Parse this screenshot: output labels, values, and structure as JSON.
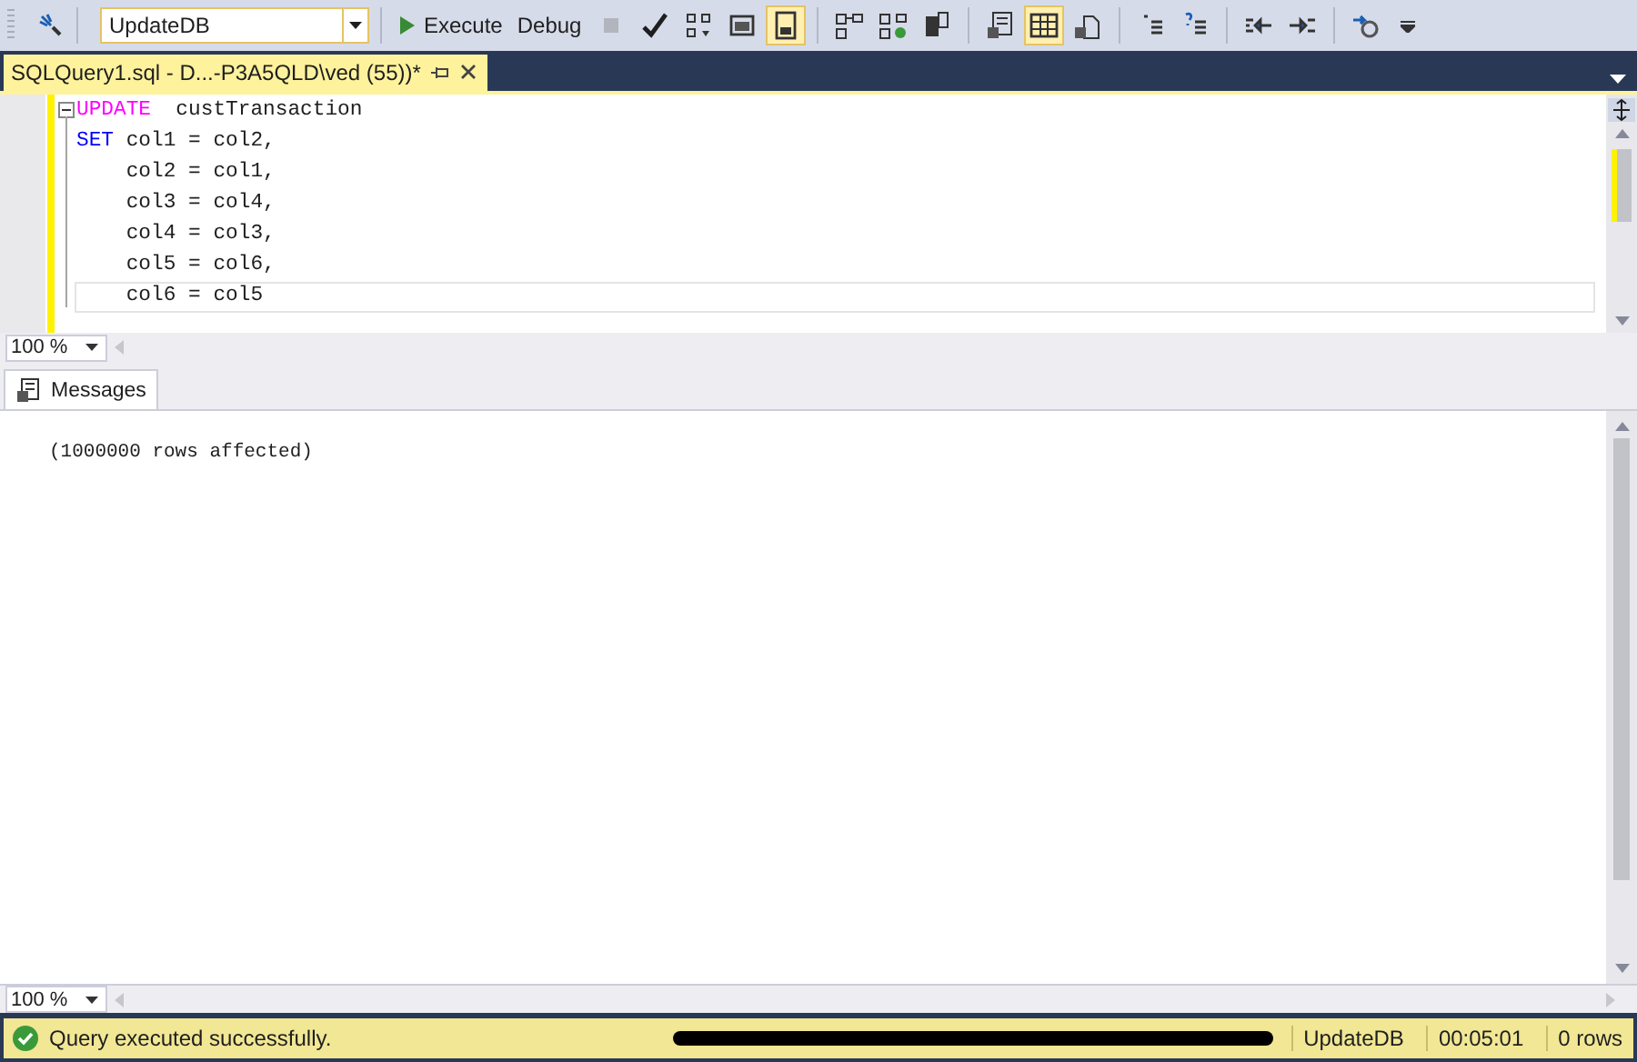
{
  "toolbar": {
    "database": "UpdateDB",
    "items": [
      {
        "kind": "text",
        "label": "Execute",
        "disabled": false
      },
      {
        "kind": "text",
        "label": "Debug",
        "disabled": false
      },
      {
        "kind": "icon",
        "disabled": true
      },
      {
        "kind": "icon",
        "disabled": false
      },
      {
        "kind": "icon",
        "disabled": false
      },
      {
        "kind": "icon",
        "disabled": false
      },
      {
        "kind": "toggle",
        "selected": true,
        "disabled": false
      },
      {
        "kind": "separator"
      },
      {
        "kind": "toggle",
        "selected": false,
        "disabled": false
      },
      {
        "kind": "toggle",
        "selected": false,
        "disabled": false
      },
      {
        "kind": "toggle",
        "selected": false,
        "disabled": false
      },
      {
        "kind": "separator"
      },
      {
        "kind": "toggle",
        "selected": false,
        "disabled": false
      },
      {
        "kind": "toggle",
        "selected": true,
        "disabled": false
      },
      {
        "kind": "toggle",
        "selected": false,
        "disabled": false
      },
      {
        "kind": "separator"
      },
      {
        "kind": "icon",
        "disabled": false
      },
      {
        "kind": "icon",
        "disabled": false
      },
      {
        "kind": "separator"
      },
      {
        "kind": "icon",
        "disabled": false
      },
      {
        "kind": "icon",
        "disabled": false
      },
      {
        "kind": "separator"
      },
      {
        "kind": "icon",
        "disabled": false
      }
    ]
  },
  "document_tab": {
    "title": "SQLQuery1.sql - D...-P3A5QLD\\ved (55))*",
    "selected": true
  },
  "editor": {
    "lines": [
      {
        "kind": "dml",
        "keyword": "UPDATE",
        "text": "  custTransaction",
        "current": false
      },
      {
        "kind": "reserved",
        "keyword": "SET",
        "text": " col1 = col2,",
        "current": false
      },
      {
        "kind": "plain",
        "text": "    col2 = col1,",
        "current": false
      },
      {
        "kind": "plain",
        "text": "    col3 = col4,",
        "current": false
      },
      {
        "kind": "plain",
        "text": "    col4 = col3,",
        "current": false
      },
      {
        "kind": "plain",
        "text": "    col5 = col6,",
        "current": false
      },
      {
        "kind": "plain",
        "text": "    col6 = col5",
        "current": true
      }
    ],
    "zoom": "100 %"
  },
  "results": {
    "tabs": [
      {
        "label": "Messages",
        "selected": true
      }
    ],
    "messages": [
      "(1000000 rows affected)"
    ],
    "zoom": "100 %"
  },
  "status_bar": {
    "message": "Query executed successfully.",
    "database": "UpdateDB",
    "elapsed": "00:05:01",
    "rows": "0 rows"
  }
}
